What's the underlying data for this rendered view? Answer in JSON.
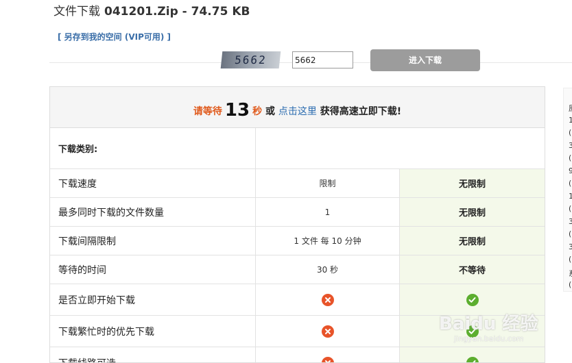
{
  "header": {
    "title_prefix": "文件下载",
    "file_name": "041201.Zip - 74.75 KB",
    "save_link": "[ 另存到我的空间 (VIP可用) ]"
  },
  "wait_bar": {
    "text_before": "请等待",
    "seconds": "13",
    "unit": "秒",
    "or": "或",
    "link": "点击这里",
    "text_after": "获得高速立即下载!"
  },
  "captcha_row": {
    "label": "下载类别:",
    "captcha_text": "5662",
    "input_value": "5662",
    "button_label": "进入下载"
  },
  "rows": [
    {
      "label": "下载速度",
      "free": "限制",
      "vip": "无限制"
    },
    {
      "label": "最多同时下载的文件数量",
      "free": "1",
      "vip": "无限制"
    },
    {
      "label": "下载间隔限制",
      "free": "1 文件 每 10 分钟",
      "vip": "无限制"
    },
    {
      "label": "等待的时间",
      "free": "30 秒",
      "vip": "不等待"
    },
    {
      "label": "是否立即开始下载",
      "free_icon": "x-circle-icon",
      "vip_icon": "check-circle-icon"
    },
    {
      "label": "下载繁忙时的优先下载",
      "free_icon": "x-circle-icon",
      "vip_icon": "check-circle-icon"
    },
    {
      "label": "下载线路可选",
      "free_icon": "x-circle-icon",
      "vip_icon": "check-circle-icon"
    }
  ],
  "side_chars": [
    "原",
    "1",
    "(",
    "3",
    "(",
    "9",
    "(",
    "1",
    "(",
    "3",
    "(",
    "3",
    "(",
    "系",
    "("
  ],
  "watermark": {
    "main": "Baidu 经验",
    "sub": "jingyan.baidu.com"
  },
  "colors": {
    "accent_orange": "#e05a1c",
    "link_blue": "#2b6cb0",
    "vip_bg": "#f4f9ea",
    "icon_x": "#e8542a",
    "icon_check": "#5cae2f"
  }
}
